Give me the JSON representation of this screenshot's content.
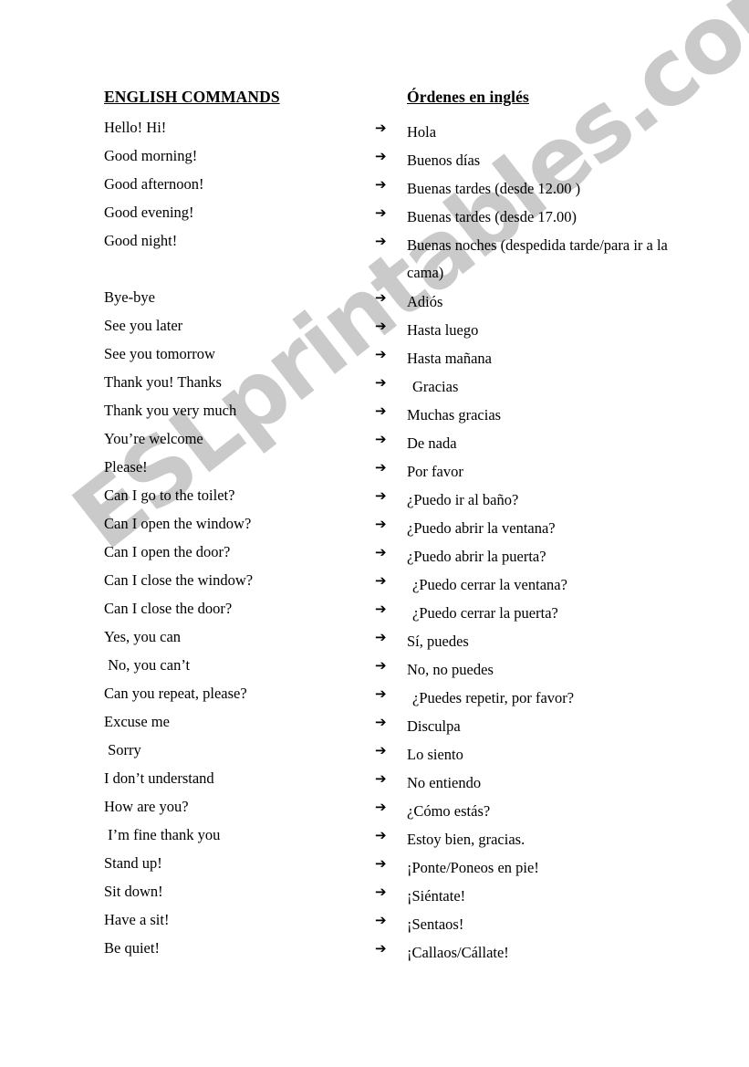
{
  "headers": {
    "english": "ENGLISH COMMANDS",
    "spanish": "Órdenes en inglés"
  },
  "watermark": {
    "text": "ESLprintables.com",
    "color": "#cacaca"
  },
  "arrow_glyph": "➔",
  "rows": [
    {
      "en": "Hello! Hi!",
      "es": "Hola"
    },
    {
      "en": "Good morning!",
      "es": "Buenos días"
    },
    {
      "en": "Good afternoon!",
      "es": "Buenas tardes (desde 12.00 )"
    },
    {
      "en": "Good evening!",
      "es": "Buenas tardes (desde 17.00)"
    },
    {
      "en": "Good night!",
      "es": "Buenas noches (despedida tarde/para ir a la cama)",
      "tall": true,
      "spacer_after": true
    },
    {
      "en": "Bye-bye",
      "es": "Adiós"
    },
    {
      "en": "See you later",
      "es": "Hasta luego"
    },
    {
      "en": "See you tomorrow",
      "es": "Hasta mañana"
    },
    {
      "en": "Thank you! Thanks",
      "es": "Gracias",
      "indent": true
    },
    {
      "en": "Thank you very much",
      "es": "Muchas gracias"
    },
    {
      "en": "You’re welcome",
      "es": "De nada"
    },
    {
      "en": "Please!",
      "es": "Por favor"
    },
    {
      "en": "Can I go to the toilet?",
      "es": "¿Puedo ir al baño?"
    },
    {
      "en": "Can I open the window?",
      "es": "¿Puedo abrir la ventana?"
    },
    {
      "en": "Can I open the door?",
      "es": "¿Puedo abrir la puerta?"
    },
    {
      "en": "Can I close the window?",
      "es": "¿Puedo cerrar la ventana?",
      "indent": true
    },
    {
      "en": "Can I close the door?",
      "es": "¿Puedo cerrar la puerta?",
      "indent": true
    },
    {
      "en": "Yes, you can",
      "es": "Sí, puedes"
    },
    {
      "en": " No, you can’t",
      "es": "No, no puedes"
    },
    {
      "en": "Can you repeat, please?",
      "es": "¿Puedes repetir, por favor?",
      "indent": true
    },
    {
      "en": "Excuse me",
      "es": "Disculpa"
    },
    {
      "en": " Sorry",
      "es": "Lo siento"
    },
    {
      "en": "I don’t understand",
      "es": "No entiendo"
    },
    {
      "en": "How are you?",
      "es": "¿Cómo estás?"
    },
    {
      "en": " I’m fine thank you",
      "es": "Estoy bien, gracias."
    },
    {
      "en": "Stand up!",
      "es": "¡Ponte/Poneos en pie!"
    },
    {
      "en": "Sit down!",
      "es": "¡Siéntate!"
    },
    {
      "en": "Have a sit!",
      "es": "¡Sentaos!"
    },
    {
      "en": "Be quiet!",
      "es": "¡Callaos/Cállate!"
    }
  ]
}
